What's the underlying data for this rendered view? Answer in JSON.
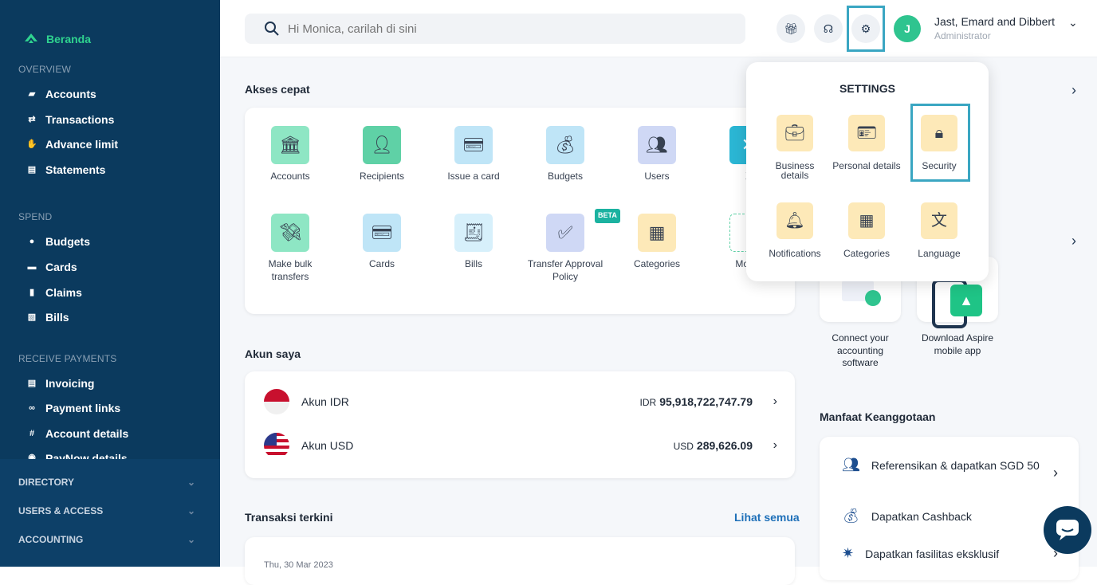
{
  "sidebar": {
    "brand": "Beranda",
    "sections": {
      "overview": "OVERVIEW",
      "spend": "SPEND",
      "receive": "RECEIVE PAYMENTS"
    },
    "overview": [
      "Accounts",
      "Transactions",
      "Advance limit",
      "Statements"
    ],
    "spend": [
      "Budgets",
      "Cards",
      "Claims",
      "Bills"
    ],
    "receive": [
      "Invoicing",
      "Payment links",
      "Account details",
      "PayNow details"
    ],
    "groups": [
      "DIRECTORY",
      "USERS & ACCESS",
      "ACCOUNTING"
    ]
  },
  "search": {
    "placeholder": "Hi Monica, carilah di sini"
  },
  "user": {
    "initial": "J",
    "name": "Jast, Emard and Dibbert",
    "role": "Administrator"
  },
  "quick": {
    "title": "Akses cepat",
    "items": [
      "Accounts",
      "Recipients",
      "Issue a card",
      "Budgets",
      "Users",
      "X",
      "Make bulk transfers",
      "Cards",
      "Bills",
      "Transfer Approval Policy",
      "Categories",
      "Mod"
    ],
    "beta": "BETA"
  },
  "accounts": {
    "title": "Akun saya",
    "rows": [
      {
        "name": "Akun IDR",
        "cur": "IDR",
        "amount": "95,918,722,747.79"
      },
      {
        "name": "Akun USD",
        "cur": "USD",
        "amount": "289,626.09"
      }
    ]
  },
  "transactions": {
    "title": "Transaksi terkini",
    "link": "Lihat semua",
    "date": "Thu, 30 Mar 2023"
  },
  "settings": {
    "title": "SETTINGS",
    "items": [
      "Business details",
      "Personal details",
      "Security",
      "Notifications",
      "Categories",
      "Language"
    ]
  },
  "rightcards": {
    "connect": "Connect your accounting software",
    "download": "Download Aspire mobile app"
  },
  "membership": {
    "title": "Manfaat Keanggotaan",
    "items": [
      "Referensikan & dapatkan SGD 50",
      "Dapatkan Cashback",
      "Dapatkan fasilitas eksklusif"
    ]
  },
  "colors": {
    "sidebar": "#0b3a5e",
    "accent": "#2fd38f",
    "highlight": "#3aa6c2"
  }
}
